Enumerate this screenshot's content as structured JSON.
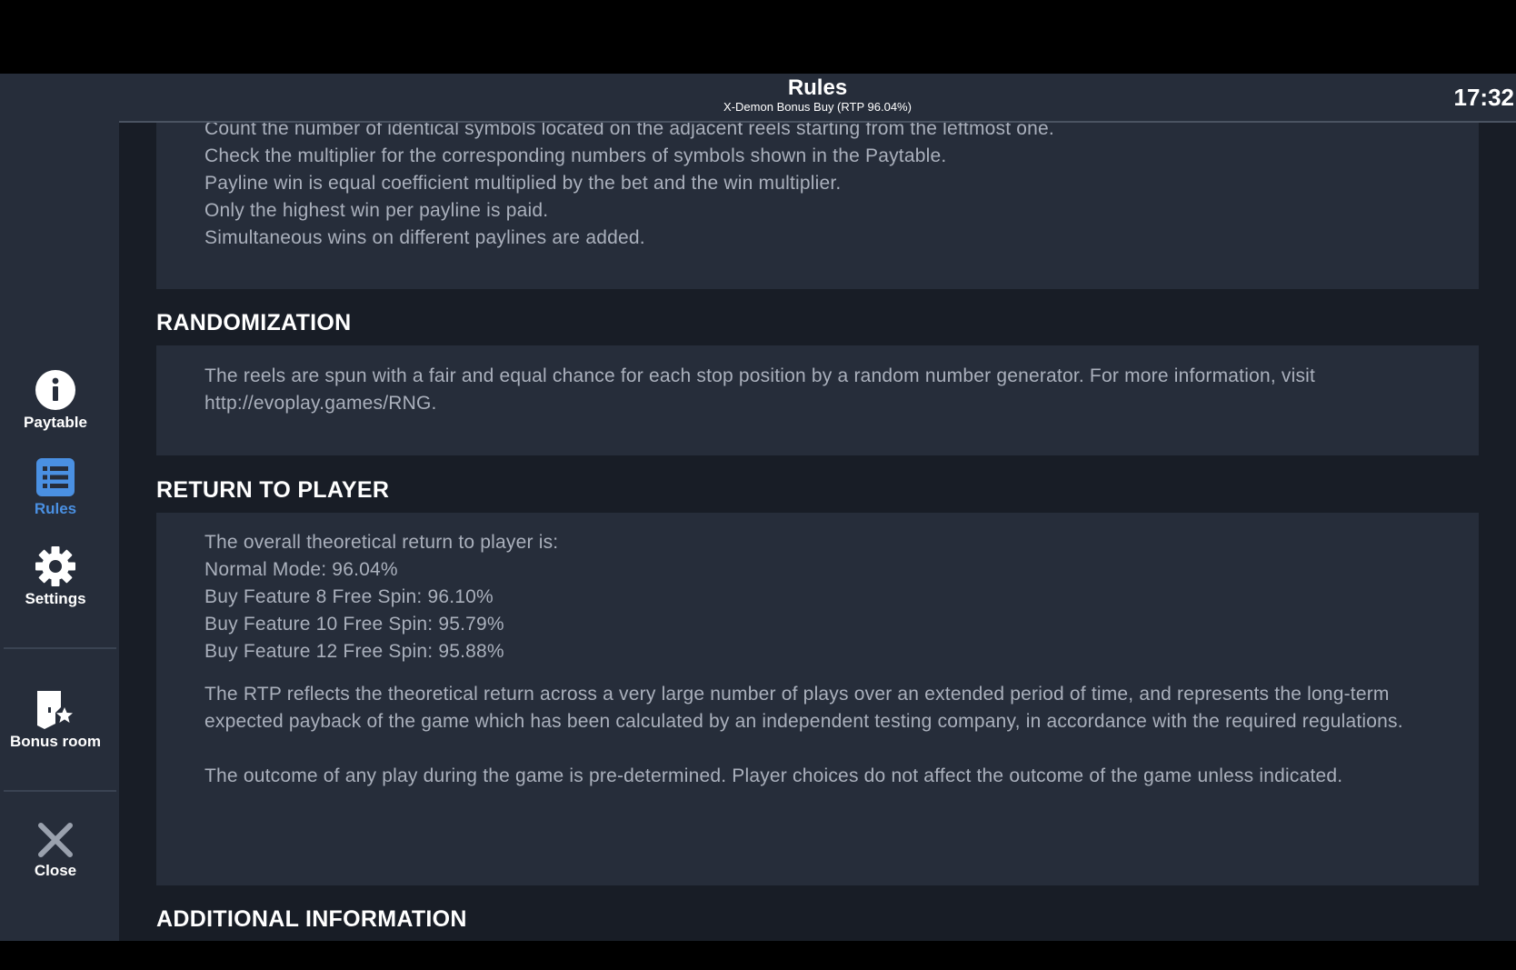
{
  "header": {
    "title": "Rules",
    "subtitle": "X-Demon Bonus Buy (RTP 96.04%)",
    "time": "17:32"
  },
  "sidebar": {
    "items": [
      {
        "label": "Paytable",
        "icon": "info-icon"
      },
      {
        "label": "Rules",
        "icon": "list-icon",
        "active": true
      },
      {
        "label": "Settings",
        "icon": "gear-icon"
      },
      {
        "label": "Bonus room",
        "icon": "door-star-icon"
      },
      {
        "label": "Close",
        "icon": "close-icon"
      }
    ],
    "active_color": "#4a90e2"
  },
  "sections": {
    "paylines": {
      "lines": [
        "Count the number of identical symbols located on the adjacent reels starting from the leftmost one.",
        "Check the multiplier for the corresponding numbers of symbols shown in the Paytable.",
        "Payline win is equal coefficient multiplied by the bet and the win multiplier.",
        "Only the highest win per payline is paid.",
        "Simultaneous wins on different paylines are added."
      ]
    },
    "randomization": {
      "title": "RANDOMIZATION",
      "text": "The reels are spun with a fair and equal chance for each stop position by a random number generator. For more information, visit http://evoplay.games/RNG."
    },
    "rtp": {
      "title": "RETURN TO PLAYER",
      "lines": [
        "The overall theoretical return to player is:",
        "Normal Mode: 96.04%",
        "Buy Feature 8 Free Spin: 96.10%",
        "Buy Feature 10 Free Spin: 95.79%",
        "Buy Feature 12 Free Spin: 95.88%"
      ],
      "paragraph1": "The RTP reflects the theoretical return across a very large number of plays over an extended period of time, and represents the long-term expected payback of the game which has been calculated by an independent testing company, in accordance with the required regulations.",
      "paragraph2": "The outcome of any play during the game is pre-determined. Player choices do not affect the outcome of the game unless indicated."
    },
    "additional": {
      "title": "ADDITIONAL INFORMATION"
    }
  }
}
